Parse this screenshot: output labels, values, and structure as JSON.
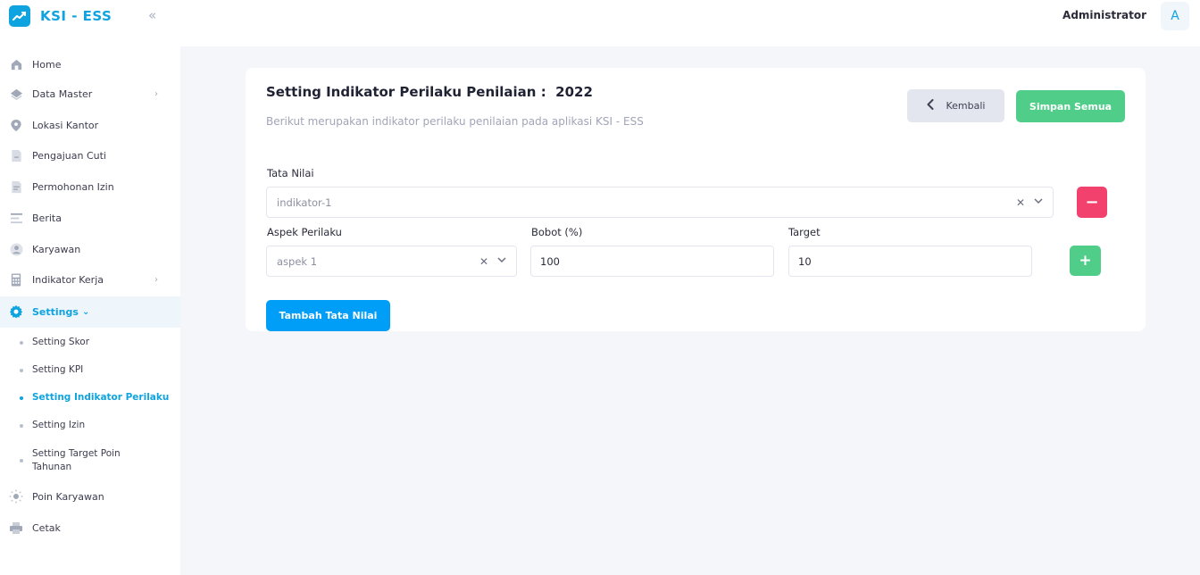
{
  "brand": {
    "name": "KSI - ESS",
    "logo_icon": "trend-chart-icon"
  },
  "colors": {
    "accent": "#0fa3df",
    "success": "#50cd89",
    "danger": "#f1416c",
    "primary": "#009ef7",
    "background": "#f4f6fa"
  },
  "sidebar": {
    "items": [
      {
        "label": "Home",
        "icon": "home-icon"
      },
      {
        "label": "Data Master",
        "icon": "layers-icon",
        "chevron": "›"
      },
      {
        "label": "Lokasi Kantor",
        "icon": "map-pin-icon"
      },
      {
        "label": "Pengajuan Cuti",
        "icon": "document-icon"
      },
      {
        "label": "Permohonan Izin",
        "icon": "document-lines-icon"
      },
      {
        "label": "Berita",
        "icon": "list-icon"
      },
      {
        "label": "Karyawan",
        "icon": "user-icon"
      },
      {
        "label": "Indikator Kerja",
        "icon": "calculator-icon",
        "chevron": "›"
      },
      {
        "label": "Settings",
        "icon": "gear-icon",
        "chevron": "⌄"
      },
      {
        "label": "Poin Karyawan",
        "icon": "sun-icon"
      },
      {
        "label": "Cetak",
        "icon": "printer-icon"
      }
    ],
    "sub_items": [
      {
        "label": "Setting Skor"
      },
      {
        "label": "Setting KPI"
      },
      {
        "label": "Setting Indikator Perilaku"
      },
      {
        "label": "Setting Izin"
      },
      {
        "label": "Setting Target Poin Tahunan"
      }
    ]
  },
  "topbar": {
    "user_name": "Administrator",
    "avatar_letter": "A"
  },
  "card": {
    "title": "Setting Indikator Perilaku Penilaian :  2022",
    "subtitle": "Berikut merupakan indikator perilaku penilaian pada aplikasi KSI - ESS",
    "back_label": "Kembali",
    "save_label": "Simpan Semua",
    "tata_nilai_label": "Tata Nilai",
    "tata_nilai_value": "indikator-1",
    "aspek_label": "Aspek Perilaku",
    "aspek_value": "aspek 1",
    "bobot_label": "Bobot (%)",
    "bobot_value": "100",
    "target_label": "Target",
    "target_value": "10",
    "remove_symbol": "−",
    "add_symbol": "+",
    "add_tata_nilai_label": "Tambah Tata Nilai"
  }
}
